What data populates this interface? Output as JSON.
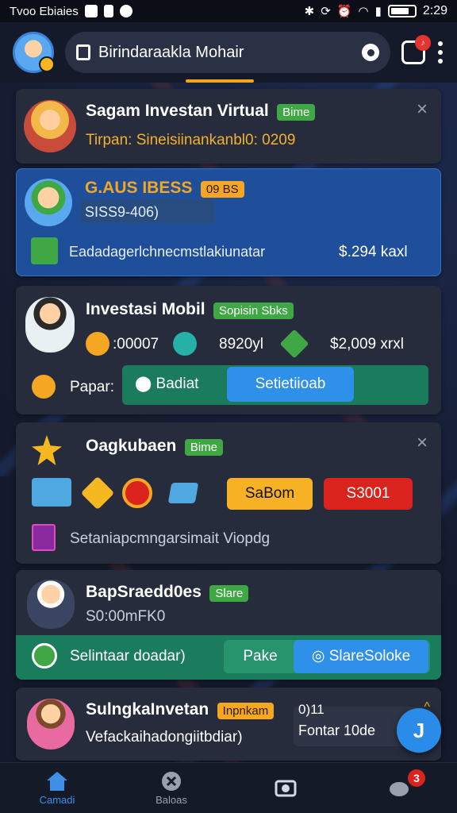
{
  "status_bar": {
    "left_text": "Tvoo Ebiaies",
    "time": "2:29"
  },
  "header": {
    "search_text": "Birindaraakla Mohair",
    "notification_count": "",
    "icons": [
      "avatar",
      "bag-icon",
      "camera-icon",
      "notification-icon",
      "kebab-icon"
    ]
  },
  "cards": [
    {
      "title": "Sagam Investan Virtual",
      "tag": "Bime",
      "subtitle": "Tirpan: Sineisiinankanbl0: 0209"
    },
    {
      "title": "G.AUS IBESS",
      "tag": "09 BS",
      "subtitle": "SISS9-406)",
      "line": "Eadadagerlchnecmstlakiunatar",
      "amount": "$.294 kaxl"
    },
    {
      "title": "Investasi Mobil",
      "tag": "Sopisin Sbks",
      "stat1": ":00007",
      "stat2": "8920yl",
      "stat3": "$2,009 xrxl",
      "label": "Papar:",
      "btn1": "Badiat",
      "btn2": "Setietiioab"
    },
    {
      "title": "Oagkubaen",
      "tag": "Bime",
      "btn1": "SaBom",
      "btn2": "S3001",
      "line": "Setaniapcmngarsimait Viopdg"
    },
    {
      "title": "BapSraedd0es",
      "tag": "Slare",
      "subtitle": "S0:00mFK0",
      "row_label": "Selintaar doadar)",
      "btn1": "Pake",
      "btn2": "SlareSoloke"
    },
    {
      "title": "SulngkaInvetan",
      "tag": "Inpnkam",
      "subtitle": "Vefackaihadongiitbdiar)",
      "side_top": "0)11",
      "side_bottom": "Fontar 10de"
    }
  ],
  "nav": {
    "items": [
      {
        "label": "Camadi",
        "active": true
      },
      {
        "label": "Baloas",
        "active": false
      },
      {
        "label": "",
        "active": false
      },
      {
        "label": "",
        "active": false
      }
    ],
    "badge": "3"
  },
  "colors": {
    "accent_blue": "#2a8be8",
    "green": "#3fa844",
    "orange": "#f5a623",
    "red": "#d9231c"
  }
}
